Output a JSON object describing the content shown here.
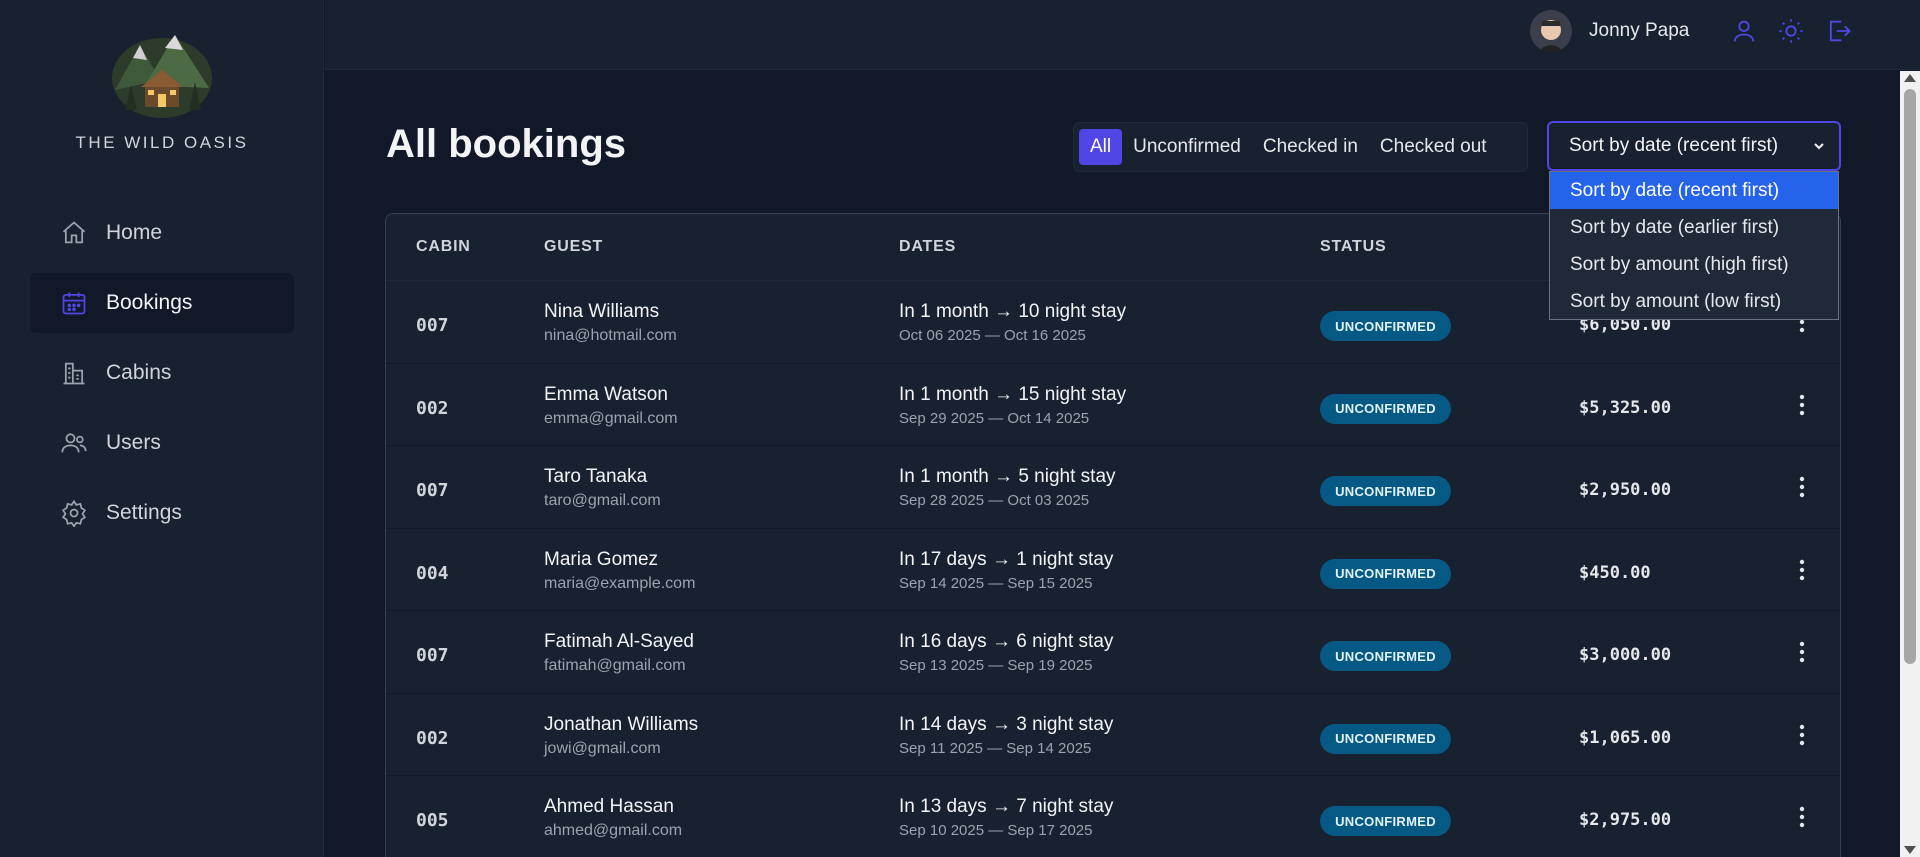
{
  "app": {
    "brand": "THE WILD OASIS"
  },
  "sidebar": {
    "items": [
      {
        "label": "Home",
        "icon": "home-icon",
        "active": false
      },
      {
        "label": "Bookings",
        "icon": "calendar-icon",
        "active": true
      },
      {
        "label": "Cabins",
        "icon": "cabins-icon",
        "active": false
      },
      {
        "label": "Users",
        "icon": "users-icon",
        "active": false
      },
      {
        "label": "Settings",
        "icon": "settings-icon",
        "active": false
      }
    ]
  },
  "header": {
    "user_name": "Jonny Papa",
    "icons": [
      "user-icon",
      "sun-icon",
      "logout-icon"
    ]
  },
  "page": {
    "title": "All bookings"
  },
  "filter": {
    "options": [
      "All",
      "Unconfirmed",
      "Checked in",
      "Checked out"
    ],
    "active": "All"
  },
  "sort": {
    "selected": "Sort by date (recent first)",
    "options": [
      "Sort by date (recent first)",
      "Sort by date (earlier first)",
      "Sort by amount (high first)",
      "Sort by amount (low first)"
    ]
  },
  "table": {
    "headers": [
      "CABIN",
      "GUEST",
      "DATES",
      "STATUS"
    ],
    "rows": [
      {
        "cabin": "007",
        "name": "Nina Williams",
        "email": "nina@hotmail.com",
        "stay": "In 1 month → 10 night stay",
        "range": "Oct 06 2025 — Oct 16 2025",
        "status": "UNCONFIRMED",
        "amount": "$6,050.00"
      },
      {
        "cabin": "002",
        "name": "Emma Watson",
        "email": "emma@gmail.com",
        "stay": "In 1 month → 15 night stay",
        "range": "Sep 29 2025 — Oct 14 2025",
        "status": "UNCONFIRMED",
        "amount": "$5,325.00"
      },
      {
        "cabin": "007",
        "name": "Taro Tanaka",
        "email": "taro@gmail.com",
        "stay": "In 1 month → 5 night stay",
        "range": "Sep 28 2025 — Oct 03 2025",
        "status": "UNCONFIRMED",
        "amount": "$2,950.00"
      },
      {
        "cabin": "004",
        "name": "Maria Gomez",
        "email": "maria@example.com",
        "stay": "In 17 days → 1 night stay",
        "range": "Sep 14 2025 — Sep 15 2025",
        "status": "UNCONFIRMED",
        "amount": "$450.00"
      },
      {
        "cabin": "007",
        "name": "Fatimah Al-Sayed",
        "email": "fatimah@gmail.com",
        "stay": "In 16 days → 6 night stay",
        "range": "Sep 13 2025 — Sep 19 2025",
        "status": "UNCONFIRMED",
        "amount": "$3,000.00"
      },
      {
        "cabin": "002",
        "name": "Jonathan Williams",
        "email": "jowi@gmail.com",
        "stay": "In 14 days → 3 night stay",
        "range": "Sep 11 2025 — Sep 14 2025",
        "status": "UNCONFIRMED",
        "amount": "$1,065.00"
      },
      {
        "cabin": "005",
        "name": "Ahmed Hassan",
        "email": "ahmed@gmail.com",
        "stay": "In 13 days → 7 night stay",
        "range": "Sep 10 2025 — Sep 17 2025",
        "status": "UNCONFIRMED",
        "amount": "$2,975.00"
      }
    ]
  },
  "colors": {
    "accent": "#4f46e5",
    "badge_bg": "#075985",
    "badge_text": "#e0f2fe",
    "dropdown_selected": "#2563eb"
  }
}
